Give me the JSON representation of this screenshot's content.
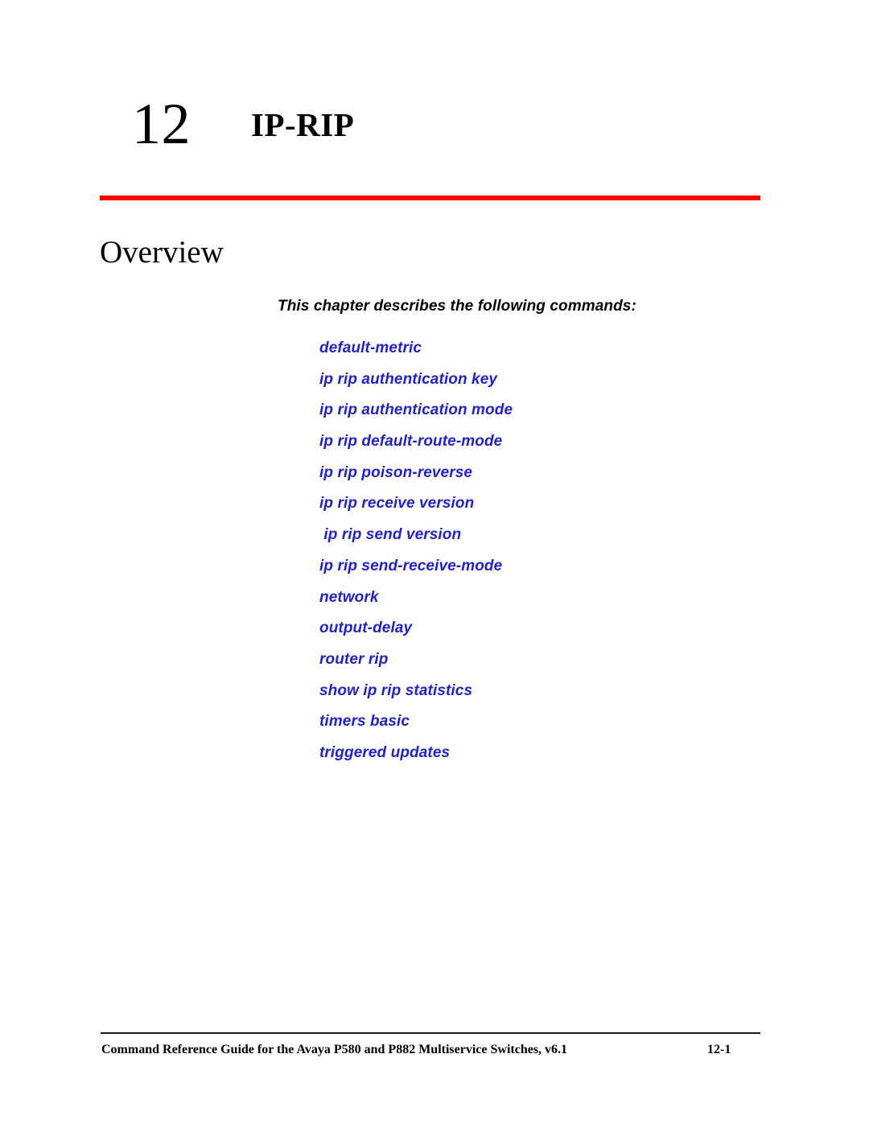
{
  "chapter": {
    "number": "12",
    "title": "IP-RIP"
  },
  "section": {
    "heading": "Overview",
    "intro": "This chapter describes the following commands:",
    "commands": [
      "default-metric",
      "ip rip authentication key",
      "ip rip authentication mode",
      "ip rip default-route-mode",
      "ip rip poison-reverse",
      "ip rip receive version",
      " ip rip send version",
      "ip rip send-receive-mode",
      "network",
      "output-delay",
      "router rip",
      "show ip rip statistics",
      "timers basic",
      "triggered updates"
    ]
  },
  "footer": {
    "text": "Command Reference Guide for the Avaya P580 and P882 Multiservice Switches, v6.1",
    "page_number": "12-1"
  },
  "colors": {
    "rule_red": "#ff0000",
    "command_blue": "#1f1fd4",
    "footer_rule": "#1b1b1b",
    "text_black": "#000000"
  }
}
